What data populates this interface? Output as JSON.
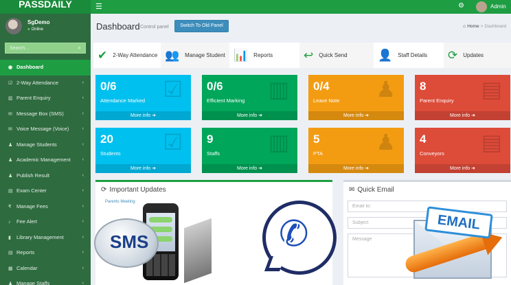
{
  "app": {
    "logo": "PASSDAILY"
  },
  "topbar": {
    "menu_icon": "hamburger-icon",
    "settings_icon": "gear-icon",
    "admin_name": "Admin"
  },
  "user": {
    "name": "SgDemo",
    "status": "Online"
  },
  "search": {
    "placeholder": "Search..."
  },
  "sidebar": {
    "items": [
      {
        "label": "Dashboard",
        "icon": "dashboard-icon",
        "active": true
      },
      {
        "label": "2-Way Attendance",
        "icon": "checkbox-icon"
      },
      {
        "label": "Parent Enquiry",
        "icon": "bar-chart-icon"
      },
      {
        "label": "Message Box (SMS)",
        "icon": "envelope-icon"
      },
      {
        "label": "Voice Message (Voice)",
        "icon": "envelope-icon"
      },
      {
        "label": "Manage Students",
        "icon": "users-icon"
      },
      {
        "label": "Academic Management",
        "icon": "users-icon"
      },
      {
        "label": "Publish Result",
        "icon": "users-icon"
      },
      {
        "label": "Exam Center",
        "icon": "document-icon"
      },
      {
        "label": "Manage Fees",
        "icon": "rupee-icon"
      },
      {
        "label": "Fee Alert",
        "icon": "bell-icon"
      },
      {
        "label": "Library Management",
        "icon": "book-icon"
      },
      {
        "label": "Reports",
        "icon": "document-icon"
      },
      {
        "label": "Calendar",
        "icon": "calendar-icon"
      },
      {
        "label": "Manage Staffs",
        "icon": "users-icon"
      }
    ]
  },
  "header": {
    "title": "Dashboard",
    "subtitle": "Control panel",
    "switch_button": "Switch To Old Panel",
    "breadcrumb": {
      "home": "Home",
      "separator": ">",
      "current": "Dashboard"
    }
  },
  "quick": [
    {
      "label": "2-Way Attendance",
      "icon": "check-icon",
      "glyph": "✔"
    },
    {
      "label": "Manage Student",
      "icon": "users-icon",
      "glyph": "👥"
    },
    {
      "label": "Reports",
      "icon": "bar-chart-icon",
      "glyph": "📊"
    },
    {
      "label": "Quick Send",
      "icon": "reply-icon",
      "glyph": "↩"
    },
    {
      "label": "Staff Details",
      "icon": "user-icon",
      "glyph": "👤"
    },
    {
      "label": "Updates",
      "icon": "refresh-icon",
      "glyph": "⟳"
    }
  ],
  "stats": [
    {
      "value": "0/6",
      "label": "Attendance Marked",
      "color": "#00c0ef",
      "icon": "checkbox-icon",
      "more": "More info"
    },
    {
      "value": "0/6",
      "label": "Efficient Marking",
      "color": "#00a65a",
      "icon": "bar-chart-icon",
      "more": "More info"
    },
    {
      "value": "0/4",
      "label": "Leave Note",
      "color": "#f39c12",
      "icon": "user-add-icon",
      "more": "More info"
    },
    {
      "value": "8",
      "label": "Parent Enquiry",
      "color": "#dd4b39",
      "icon": "document-icon",
      "more": "More info"
    },
    {
      "value": "20",
      "label": "Students",
      "color": "#00c0ef",
      "icon": "checkbox-icon",
      "more": "More info"
    },
    {
      "value": "9",
      "label": "Staffs",
      "color": "#00a65a",
      "icon": "bar-chart-icon",
      "more": "More info"
    },
    {
      "value": "5",
      "label": "PTA",
      "color": "#f39c12",
      "icon": "user-add-icon",
      "more": "More info"
    },
    {
      "value": "4",
      "label": "Conveyors",
      "color": "#dd4b39",
      "icon": "document-icon",
      "more": "More info"
    }
  ],
  "updates": {
    "title": "Important Updates",
    "item": "Parents Meeting"
  },
  "quick_email": {
    "title": "Quick Email",
    "to_placeholder": "Email to:",
    "subject_placeholder": "Subject",
    "message_placeholder": "Message"
  },
  "overlay": {
    "sms_label": "SMS",
    "email_label": "EMAIL"
  },
  "colors": {
    "brand_green": "#1e9d43",
    "sidebar": "#2e6b3f",
    "aqua": "#00c0ef",
    "green": "#00a65a",
    "yellow": "#f39c12",
    "red": "#dd4b39"
  }
}
